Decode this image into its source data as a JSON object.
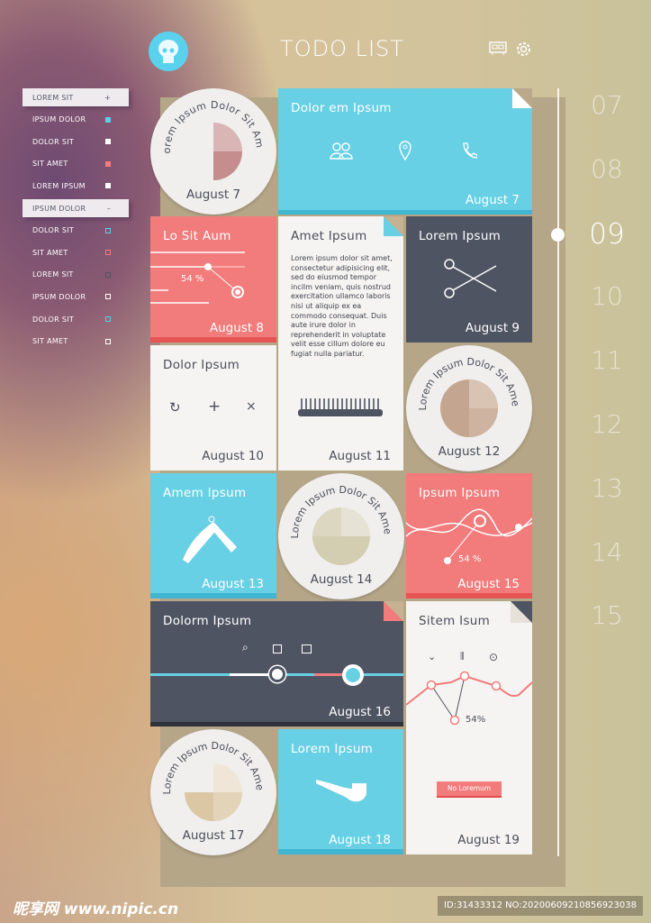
{
  "header": {
    "title": "TODO LIST",
    "avatar_icon": "skull-avatar-icon",
    "icons": [
      "display-icon",
      "gear-icon"
    ]
  },
  "sidebar": {
    "items": [
      {
        "label": "LOREM SIT",
        "marker": "+",
        "highlighted": true
      },
      {
        "label": "IPSUM DOLOR",
        "marker_color": "#5bcfe8"
      },
      {
        "label": "DOLOR SIT",
        "marker_color": "#ffffff"
      },
      {
        "label": "SIT AMET",
        "marker_color": "#f27b7b"
      },
      {
        "label": "LOREM IPSUM",
        "marker_color": "#ffffff"
      },
      {
        "label": "IPSUM DOLOR",
        "marker": "–",
        "highlighted": true
      },
      {
        "label": "DOLOR SIT",
        "marker_color": "#5bcfe8",
        "outline": true
      },
      {
        "label": "SIT AMET",
        "marker_color": "#f27b7b",
        "outline": true
      },
      {
        "label": "LOREM SIT",
        "marker_color": "#4f5462",
        "outline": true
      },
      {
        "label": "IPSUM DOLOR",
        "marker_color": "#ffffff",
        "outline": true
      },
      {
        "label": "DOLOR SIT",
        "marker_color": "#5bcfe8",
        "outline": true
      },
      {
        "label": "SIT AMET",
        "marker_color": "#ffffff",
        "outline": true
      }
    ]
  },
  "circle_text": "Lorem Ipsum Dolor Sit Amet",
  "cards": {
    "c7": {
      "date": "August 7"
    },
    "c7b": {
      "title": "Dolor em Ipsum",
      "date": "August 7"
    },
    "c8": {
      "title": "Lo Sit Aum",
      "percent": "54 %",
      "date": "August 8"
    },
    "c9": {
      "title": "Lorem Ipsum",
      "date": "August 9"
    },
    "c10": {
      "title": "Dolor Ipsum",
      "date": "August 10"
    },
    "c11": {
      "title": "Amet Ipsum",
      "body": "Lorem ipsum dolor sit amet, consectetur adipisicing elit, sed do eiusmod tempor incilm veniam, quis nostrud exercitation ullamco laboris nisi ut aliquip ex ea commodo consequat. Duis aute irure dolor in reprehenderit in voluptate velit esse cillum dolore eu fugiat nulla pariatur.",
      "date": "August 11"
    },
    "c12": {
      "date": "August 12"
    },
    "c13": {
      "title": "Amem Ipsum",
      "date": "August 13"
    },
    "c14": {
      "date": "August 14"
    },
    "c15": {
      "title": "Ipsum Ipsum",
      "percent": "54 %",
      "date": "August 15"
    },
    "c16": {
      "title": "Dolorm Ipsum",
      "date": "August 16",
      "slider_value": 0.42
    },
    "c17": {
      "date": "August 17"
    },
    "c18": {
      "title": "Lorem Ipsum",
      "date": "August 18"
    },
    "c19": {
      "title": "Sitem Isum",
      "percent": "54%",
      "button": "No Loremum",
      "date": "August 19"
    }
  },
  "timeline": {
    "days": [
      "07",
      "08",
      "09",
      "10",
      "11",
      "12",
      "13",
      "14",
      "15"
    ],
    "active": "09"
  },
  "colors": {
    "blue": "#67d0e4",
    "red": "#f27b7b",
    "dark": "#4f5462",
    "light": "#f6f4f2"
  },
  "watermark": {
    "logo": "昵享网 www.nipic.cn",
    "id": "ID:31433312 NO:20200609210856923038"
  }
}
